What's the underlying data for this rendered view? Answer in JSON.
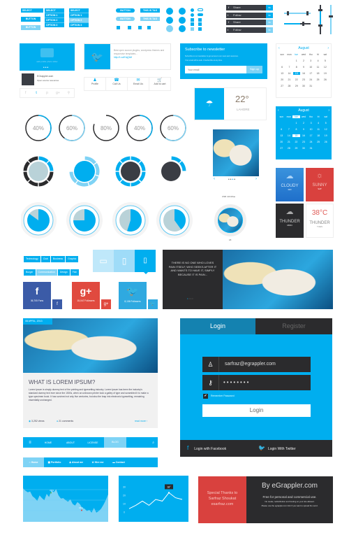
{
  "selects": [
    {
      "label": "SELECT",
      "options": []
    },
    {
      "label": "SELECT",
      "options": [
        "OPTION 1",
        "OPTION 2",
        "OPTION 3"
      ]
    },
    {
      "label": "SELECT",
      "options": [
        "OPTION 1",
        "OPTION 2",
        "OPTION 3"
      ],
      "active": 1
    }
  ],
  "buttons": {
    "button": "BUTTON",
    "this_is_tag": "THIS IS TAG"
  },
  "share_bars": [
    {
      "icon": "facebook-icon",
      "label": "Share",
      "count": "56"
    },
    {
      "icon": "twitter-icon",
      "label": "Follow",
      "count": "56"
    },
    {
      "icon": "facebook-icon",
      "label": "Share",
      "count": "56"
    },
    {
      "icon": "twitter-icon",
      "label": "Follow",
      "count": "56"
    }
  ],
  "sliders": {
    "h1": 0.8,
    "h2": 0.6,
    "v1": 0.3,
    "v2": 0.5
  },
  "profile": {
    "add_photo": "add profile photo slider",
    "name": "EGrappler.com",
    "subtitle": "Open source resources",
    "social": [
      "facebook-icon",
      "twitter-icon",
      "pinterest-icon",
      "google-plus-icon",
      "link-icon"
    ]
  },
  "tweet": {
    "text": "Best open source plugins, wordpress themes and responsive templates...",
    "link": "http://t.co/lHqQtAf"
  },
  "icon_tabs": [
    {
      "icon": "profile-icon",
      "label": "Profile"
    },
    {
      "icon": "phone-icon",
      "label": "Call Us"
    },
    {
      "icon": "email-icon",
      "label": "Email Us"
    },
    {
      "icon": "cart-icon",
      "label": "Add to cart"
    }
  ],
  "newsletter": {
    "title": "Subscribe to newsletter",
    "line1": "Subscribe to our newsletter to get access to our news and resources.",
    "line2": "Your email will be safe. Unsubscribe at any time.",
    "placeholder": "Your email",
    "button": "Sign up"
  },
  "calendar": {
    "month": "August",
    "weekdays": [
      "sun",
      "mon",
      "tue",
      "wed",
      "thu",
      "fri",
      "sat"
    ],
    "first_weekday": 2,
    "days": 31,
    "selected": 15,
    "today_weekday": "tue"
  },
  "progress_rings": [
    40,
    60,
    80,
    40,
    60
  ],
  "segmented_rings": [
    {
      "filled": 2,
      "segments": 8
    },
    {
      "filled": 5,
      "segments": 5
    },
    {
      "filled": 8,
      "segments": 8
    },
    {
      "filled": 2,
      "segments": 8
    }
  ],
  "pies": [
    85,
    75,
    55,
    40
  ],
  "weather_widget": {
    "temp": "22°",
    "city": "LAHORE",
    "icon": "rain-cloud-icon"
  },
  "slider": {
    "dots": 4,
    "active": 2
  },
  "weather_tiles": [
    {
      "label": "CLOUDY",
      "day": "FRI",
      "icon": "cloud-icon",
      "color": "#2a7fd4"
    },
    {
      "label": "SUNNY",
      "day": "SAT",
      "icon": "sun-icon",
      "color": "#d9413e"
    },
    {
      "label": "THUNDER",
      "day": "MON",
      "icon": "thunder-cloud-icon",
      "color": "#2b2b2d"
    },
    {
      "label": "THUNDER",
      "day": "TUES",
      "temp": "38°C",
      "color": "#ffffff"
    }
  ],
  "avatar": {
    "name": "USR JohnDoe",
    "count": "18"
  },
  "tags": [
    "Technology",
    "Club",
    "Business",
    "Graphic",
    "Burger",
    "Communication",
    "Design",
    "Flat",
    "Magazine",
    "Blog"
  ],
  "devices": [
    "desktop-icon",
    "tablet-icon",
    "phone-icon"
  ],
  "quote": {
    "text": "THERE IS NO ONE WHO LOVES PAIN ITSELF, WHO SEEKS AFTER IT AND WANTS TO HAVE IT, SIMPLY BECAUSE IT IS PAIN...",
    "dots": 4
  },
  "social_tiles": [
    {
      "icon": "facebook-icon",
      "glyph": "f",
      "count": "36,705 Fans",
      "color": "#3b5ba7"
    },
    {
      "icon": "google-plus-icon",
      "glyph": "g+",
      "count": "15,047 Followers",
      "color": "#e04a3f"
    },
    {
      "icon": "twitter-icon",
      "glyph": "🐦",
      "count": "8,136 Followers",
      "color": "#2fa9e0"
    }
  ],
  "blog": {
    "date": "08 APRIL, 2013",
    "title": "WHAT IS LOREM IPSUM?",
    "body": "Lorem Ipsum is simply dummy text of the printing and typesetting industry. Lorem Ipsum has been the industry's standard dummy text ever since the 1500s, when an unknown printer took a galley of type and scrambled it to make a type specimen book. It has survived not only five centuries, but also the leap into electronic typesetting, remaining essentially unchanged.",
    "views": "3,252 views",
    "comments": "21 comments",
    "read_more": "read more"
  },
  "login": {
    "tab_login": "Login",
    "tab_register": "Register",
    "email": "sarfraz@egrappler.com",
    "password": "••••••••",
    "remember": "Remember Password",
    "button": "Login",
    "facebook": "Login with Facebook",
    "twitter": "Login With Twitter"
  },
  "nav1": {
    "items": [
      "HOME",
      "ABOUT",
      "LICENSE",
      "BLOG"
    ],
    "active": 3
  },
  "nav2": {
    "items": [
      {
        "icon": "home-icon",
        "label": "Home"
      },
      {
        "icon": "portfolio-icon",
        "label": "Portfolio"
      },
      {
        "icon": "user-icon",
        "label": "About me"
      },
      {
        "icon": "star-icon",
        "label": "Hire me"
      },
      {
        "icon": "contact-icon",
        "label": "Contact"
      }
    ],
    "active": 0
  },
  "area_chart": {
    "labels": [
      "37%",
      "16%"
    ],
    "values": [
      80,
      74,
      70,
      72,
      60,
      55,
      48,
      62,
      55,
      50,
      66,
      58,
      75,
      70,
      78,
      62,
      54,
      55,
      50,
      46,
      52,
      40,
      36,
      45,
      40,
      30,
      28,
      22,
      25,
      18,
      30,
      18,
      22,
      28,
      38,
      50,
      65
    ]
  },
  "line_chart": {
    "y_ticks": [
      "30",
      "20",
      "10",
      "0"
    ],
    "ylim": [
      0,
      30
    ],
    "values": [
      4,
      8,
      13,
      8,
      15,
      13,
      23,
      17,
      15
    ],
    "tooltip": "18°"
  },
  "thanks": {
    "line1": "Special Thanks to",
    "line2": "Sarfraz Shoukat",
    "line3": "esarfraz.com"
  },
  "credit": {
    "title": "By eGrappler.com",
    "line1": "Free for personal and commercial use.",
    "line2": "No resale, redistribution and hosting on your site allowed.",
    "line3": "Please use the egrappler.com link if you want to spread the word."
  },
  "colors": {
    "accent": "#00aeef",
    "light_accent": "#7fd3f5",
    "dark": "#2b2b2d",
    "red": "#d9413e"
  }
}
